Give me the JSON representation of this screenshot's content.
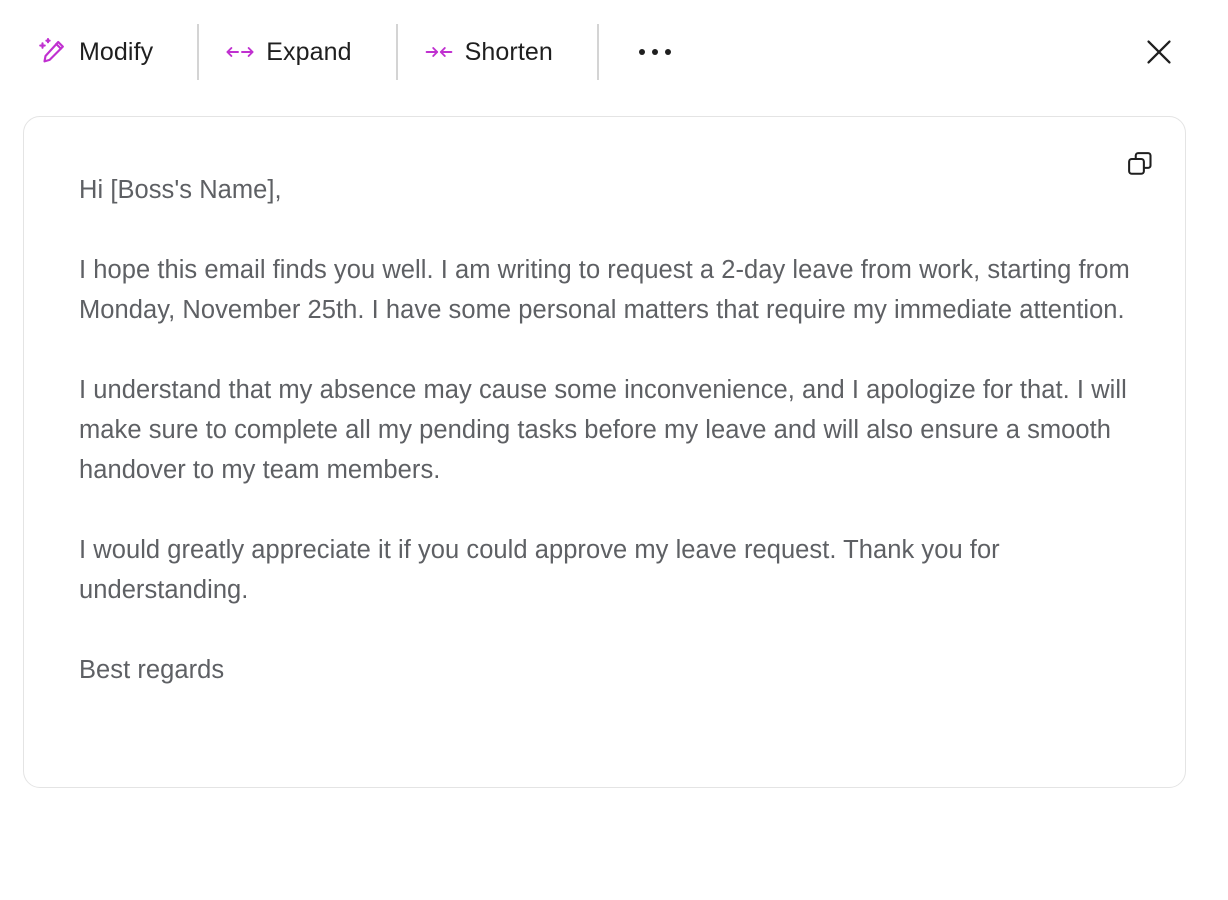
{
  "toolbar": {
    "buttons": [
      {
        "id": "modify",
        "label": "Modify",
        "icon": "magic-wand-pencil-icon"
      },
      {
        "id": "expand",
        "label": "Expand",
        "icon": "arrows-expand-icon"
      },
      {
        "id": "shorten",
        "label": "Shorten",
        "icon": "arrows-shorten-icon"
      }
    ],
    "more_label": "···",
    "more_icon": "more-horizontal-icon",
    "close_icon": "close-icon"
  },
  "card": {
    "copy_icon": "copy-icon",
    "paragraphs": [
      "Hi [Boss's Name],",
      "I hope this email finds you well. I am writing to request a 2-day leave from work, starting from Monday, November 25th. I have some personal matters that require my immediate attention.",
      "I understand that my absence may cause some inconvenience, and I apologize for that. I will make sure to complete all my pending tasks before my leave and will also ensure a smooth handover to my team members.",
      "I would greatly appreciate it if you could approve my leave request. Thank you for understanding.",
      "Best regards"
    ]
  },
  "colors": {
    "accent_purple": "#c030d0",
    "body_text": "#5e6064",
    "label_text": "#1f1f1f",
    "card_border": "#e4e4e4",
    "divider": "#d4d4d4",
    "background": "#ffffff"
  }
}
